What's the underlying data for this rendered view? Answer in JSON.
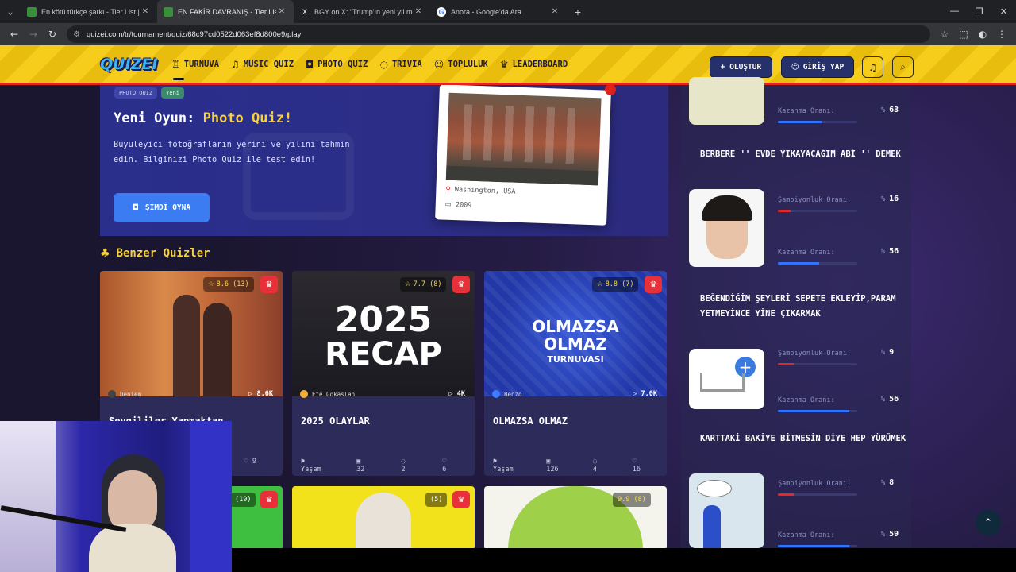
{
  "browser": {
    "tabs": [
      {
        "label": "En kötü türkçe şarkı - Tier List |",
        "active": false,
        "favicon_color": "#3a8f3a",
        "favicon_glyph": ""
      },
      {
        "label": "EN FAKİR DAVRANIŞ - Tier List",
        "active": true,
        "favicon_color": "#3a8f3a",
        "favicon_glyph": ""
      },
      {
        "label": "BGY on X: \"Trump'ın yeni yıl me",
        "active": false,
        "favicon_color": "#202124",
        "favicon_glyph": "X"
      },
      {
        "label": "Anora - Google'da Ara",
        "active": false,
        "favicon_color": "#ffffff",
        "favicon_glyph": "G"
      }
    ],
    "url": "quizei.com/tr/tournament/quiz/68c97cd0522d063ef8d800e9/play"
  },
  "header": {
    "logo_text": "QUIZEI",
    "nav": [
      {
        "label": "TURNUVA",
        "icon": "trophy-icon",
        "glyph": "♖",
        "active": true
      },
      {
        "label": "MUSIC QUIZ",
        "icon": "music-icon",
        "glyph": "♫",
        "active": false
      },
      {
        "label": "PHOTO QUIZ",
        "icon": "camera-icon",
        "glyph": "◘",
        "active": false
      },
      {
        "label": "TRIVIA",
        "icon": "chat-icon",
        "glyph": "◌",
        "active": false
      },
      {
        "label": "TOPLULUK",
        "icon": "users-icon",
        "glyph": "☺",
        "active": false
      },
      {
        "label": "LEADERBOARD",
        "icon": "crown-icon",
        "glyph": "♛",
        "active": false
      }
    ],
    "create_label": "+ OLUŞTUR",
    "login_label": "GİRİŞ YAP"
  },
  "hero": {
    "badges": [
      "PHOTO QUIZ",
      "Yeni"
    ],
    "title_prefix": "Yeni Oyun:",
    "title_highlight": "Photo Quiz!",
    "description": "Büyüleyici fotoğrafların yerini ve yılını tahmin edin. Bilginizi Photo Quiz ile test edin!",
    "play_label": "ŞİMDİ OYNA",
    "photo_location": "Washington, USA",
    "photo_year": "2009"
  },
  "similar": {
    "title": "Benzer Quizler",
    "cards": [
      {
        "title": "Sevgililer Yapmaktan",
        "rating": "8.6 (13)",
        "author": "Deniem",
        "plays": "8.6K",
        "category": "",
        "count1": "",
        "count2": "",
        "count3": "9",
        "thumb": "silhouette"
      },
      {
        "title": "2025 OLAYLAR",
        "rating": "7.7 (8)",
        "author": "Efe Gökaslan",
        "plays": "4K",
        "category": "Yaşam",
        "count1": "32",
        "count2": "2",
        "count3": "6",
        "thumb": "recap",
        "thumb_line1": "2025",
        "thumb_line2": "RECAP"
      },
      {
        "title": "OLMAZSA OLMAZ",
        "rating": "8.8 (7)",
        "author": "Benzo",
        "plays": "7.0K",
        "category": "Yaşam",
        "count1": "126",
        "count2": "4",
        "count3": "16",
        "thumb": "olmazsa",
        "thumb_line1": "OLMAZSA",
        "thumb_line2": "OLMAZ",
        "thumb_line3": "TURNUVASI"
      }
    ],
    "row2_ratings": [
      "(19)",
      "(5)",
      "9.9 (8)"
    ]
  },
  "rightcol": {
    "items": [
      {
        "title": "",
        "label1": "Kazanma Oranı:",
        "val1": "63",
        "bar1": 0.55,
        "bar1_color": "#2f73ff",
        "label2": "",
        "val2": "",
        "bar2": 0
      },
      {
        "title": "BERBERE '' EVDE YIKAYACAĞIM ABİ '' DEMEK",
        "label1": "Şampiyonluk Oranı:",
        "val1": "16",
        "bar1": 0.16,
        "bar1_color": "#e02a2a",
        "label2": "Kazanma Oranı:",
        "val2": "56",
        "bar2": 0.52,
        "bar2_color": "#2f73ff"
      },
      {
        "title": "BEĞENDİĞİM ŞEYLERİ SEPETE EKLEYİP,PARAM YETMEYİNCE YİNE ÇIKARMAK",
        "label1": "Şampiyonluk Oranı:",
        "val1": "9",
        "bar1": 0.2,
        "bar1_color": "#e02a2a",
        "label2": "Kazanma Oranı:",
        "val2": "56",
        "bar2": 0.9,
        "bar2_color": "#2f73ff"
      },
      {
        "title": "KARTTAKİ BAKİYE BİTMESİN DİYE HEP YÜRÜMEK",
        "label1": "Şampiyonluk Oranı:",
        "val1": "8",
        "bar1": 0.2,
        "bar1_color": "#e02a2a",
        "label2": "Kazanma Oranı:",
        "val2": "59",
        "bar2": 0.9,
        "bar2_color": "#2f73ff"
      }
    ],
    "pct_sign": "%"
  }
}
